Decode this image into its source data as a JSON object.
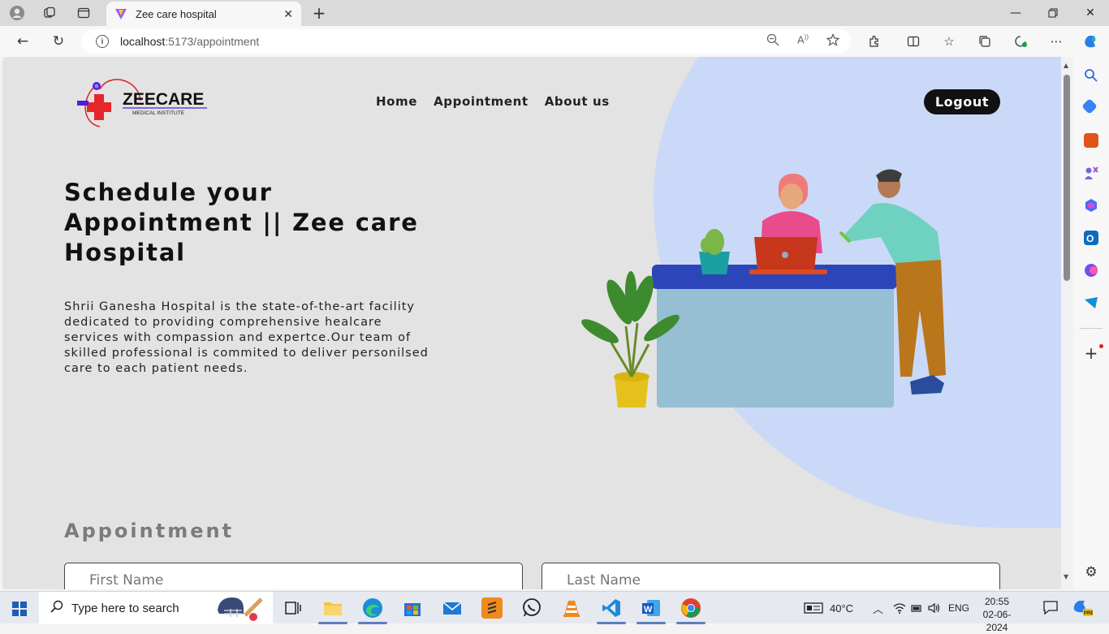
{
  "browser": {
    "tab_title": "Zee care hospital",
    "url_host": "localhost",
    "url_path": ":5173/appointment"
  },
  "site": {
    "logo_text": "ZEECARE",
    "logo_subtext": "MEDICAL INSTITUTE",
    "nav": [
      "Home",
      "Appointment",
      "About us"
    ],
    "logout_label": "Logout"
  },
  "hero": {
    "title_lines": [
      "Schedule your",
      "Appointment || Zee care",
      "Hospital"
    ],
    "description_lines": [
      "Shrii Ganesha Hospital is the state-of-the-art facility",
      "dedicated to providing comprehensive healcare",
      "services with compassion and expertce.Our team of",
      "skilled professional is commited to deliver personilsed",
      "care to each patient needs."
    ]
  },
  "appointment": {
    "heading": "Appointment",
    "first_name_placeholder": "First Name",
    "last_name_placeholder": "Last Name"
  },
  "taskbar": {
    "search_placeholder": "Type here to search",
    "temperature": "40°C",
    "language": "ENG",
    "time": "20:55",
    "date": "02-06-2024"
  },
  "colors": {
    "accent_blob": "#cad9f7",
    "page_bg": "#e3e3e3",
    "logout_bg": "#111111",
    "heading_gray": "#7b7b7b"
  }
}
